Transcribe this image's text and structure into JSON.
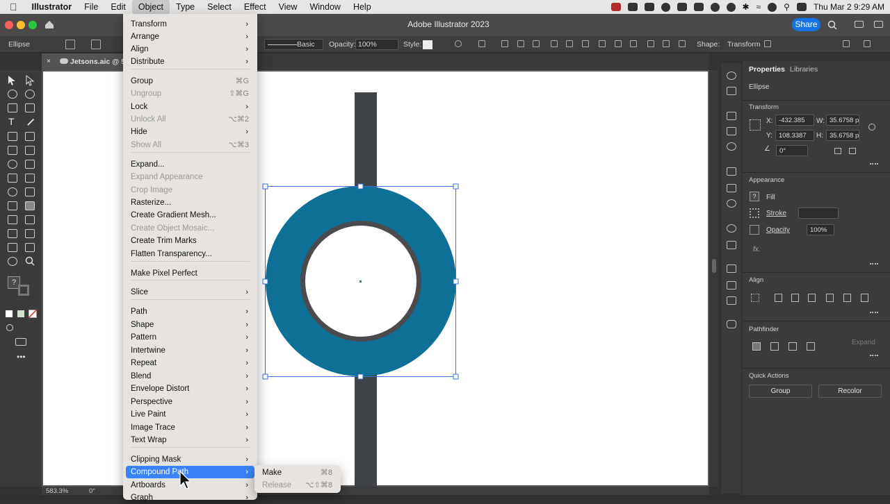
{
  "menubar": {
    "app_name": "Illustrator",
    "items": [
      "File",
      "Edit",
      "Object",
      "Type",
      "Select",
      "Effect",
      "View",
      "Window",
      "Help"
    ],
    "active_item": "Object",
    "clock": "Thu Mar 2  9:29 AM"
  },
  "window": {
    "title": "Adobe Illustrator 2023",
    "share_label": "Share"
  },
  "controlbar": {
    "selection_type": "Ellipse",
    "stroke_style": "Basic",
    "opacity_label": "Opacity:",
    "opacity_value": "100%",
    "style_label": "Style:",
    "shape_label": "Shape:",
    "transform_label": "Transform"
  },
  "document": {
    "tab_name": "Jetsons.aic @ 583",
    "zoom": "583.3%",
    "rotation": "0°"
  },
  "panel": {
    "tabs": [
      "Properties",
      "Libraries"
    ],
    "selection": "Ellipse",
    "transform": {
      "title": "Transform",
      "x_label": "X:",
      "x_value": "-432.385",
      "y_label": "Y:",
      "y_value": "108.3387",
      "w_label": "W:",
      "w_value": "35.6758 p",
      "h_label": "H:",
      "h_value": "35.6758 p",
      "angle": "0°"
    },
    "appearance": {
      "title": "Appearance",
      "fill_label": "Fill",
      "stroke_label": "Stroke",
      "opacity_label": "Opacity",
      "opacity_value": "100%",
      "fx_label": "fx."
    },
    "align_title": "Align",
    "pathfinder": {
      "title": "Pathfinder",
      "expand_label": "Expand"
    },
    "quick_actions": {
      "title": "Quick Actions",
      "group_label": "Group",
      "recolor_label": "Recolor"
    }
  },
  "object_menu": {
    "items": [
      {
        "label": "Transform",
        "submenu": true
      },
      {
        "label": "Arrange",
        "submenu": true
      },
      {
        "label": "Align",
        "submenu": true
      },
      {
        "label": "Distribute",
        "submenu": true
      },
      {
        "label": "Group",
        "shortcut": "⌘G"
      },
      {
        "label": "Ungroup",
        "shortcut": "⇧⌘G",
        "disabled": true
      },
      {
        "label": "Lock",
        "submenu": true
      },
      {
        "label": "Unlock All",
        "shortcut": "⌥⌘2",
        "disabled": true
      },
      {
        "label": "Hide",
        "submenu": true
      },
      {
        "label": "Show All",
        "shortcut": "⌥⌘3",
        "disabled": true
      },
      {
        "label": "Expand..."
      },
      {
        "label": "Expand Appearance",
        "disabled": true
      },
      {
        "label": "Crop Image",
        "disabled": true
      },
      {
        "label": "Rasterize..."
      },
      {
        "label": "Create Gradient Mesh..."
      },
      {
        "label": "Create Object Mosaic...",
        "disabled": true
      },
      {
        "label": "Create Trim Marks"
      },
      {
        "label": "Flatten Transparency..."
      },
      {
        "label": "Make Pixel Perfect"
      },
      {
        "label": "Slice",
        "submenu": true
      },
      {
        "label": "Path",
        "submenu": true
      },
      {
        "label": "Shape",
        "submenu": true
      },
      {
        "label": "Pattern",
        "submenu": true
      },
      {
        "label": "Intertwine",
        "submenu": true
      },
      {
        "label": "Repeat",
        "submenu": true
      },
      {
        "label": "Blend",
        "submenu": true
      },
      {
        "label": "Envelope Distort",
        "submenu": true
      },
      {
        "label": "Perspective",
        "submenu": true
      },
      {
        "label": "Live Paint",
        "submenu": true
      },
      {
        "label": "Image Trace",
        "submenu": true
      },
      {
        "label": "Text Wrap",
        "submenu": true
      },
      {
        "label": "Clipping Mask",
        "submenu": true
      },
      {
        "label": "Compound Path",
        "submenu": true,
        "highlighted": true
      },
      {
        "label": "Artboards",
        "submenu": true
      },
      {
        "label": "Graph",
        "submenu": true
      }
    ]
  },
  "compound_path_submenu": {
    "items": [
      {
        "label": "Make",
        "shortcut": "⌘8"
      },
      {
        "label": "Release",
        "shortcut": "⌥⇧⌘8",
        "disabled": true
      }
    ]
  },
  "colors": {
    "ring_fill": "#0e7096",
    "ring_inner_stroke": "#4a4a4f",
    "bar_fill": "#404348",
    "selection_blue": "#3a6fd8",
    "menu_highlight": "#3a82f7"
  }
}
